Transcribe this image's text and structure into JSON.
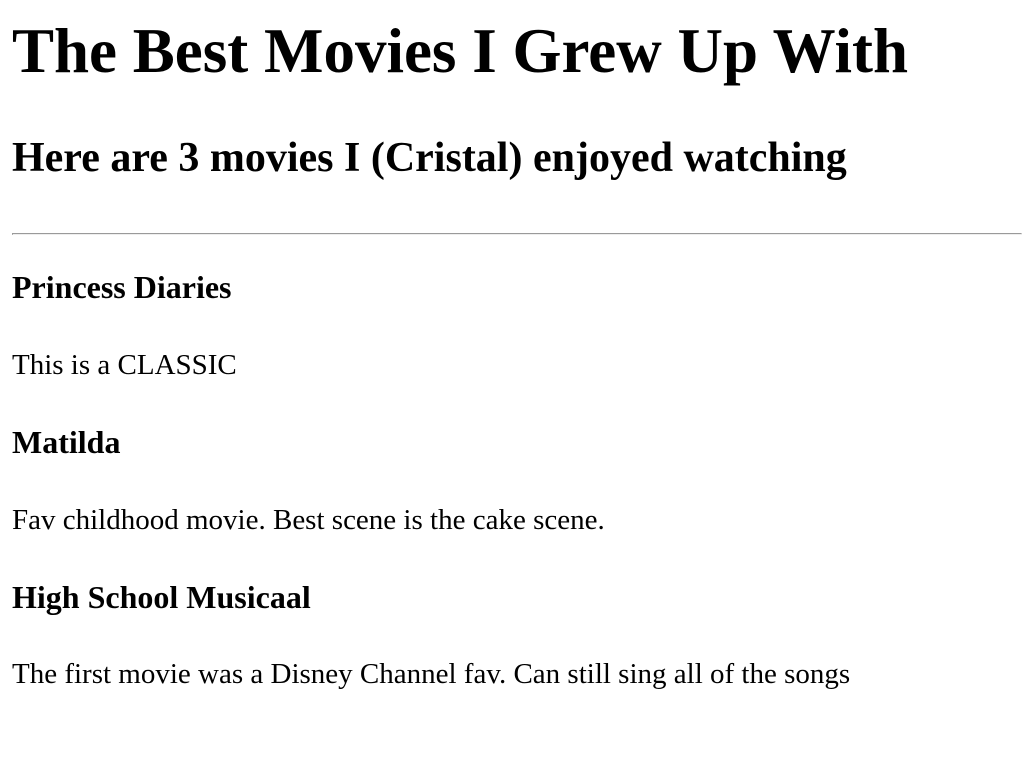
{
  "page": {
    "title": "The Best Movies I Grew Up With",
    "subtitle": "Here are 3 movies I (Cristal) enjoyed watching"
  },
  "movies": [
    {
      "title": "Princess Diaries",
      "description": "This is a CLASSIC"
    },
    {
      "title": "Matilda",
      "description": "Fav childhood movie. Best scene is the cake scene."
    },
    {
      "title": "High School Musicaal",
      "description": "The first movie was a Disney Channel fav. Can still sing all of the songs"
    }
  ]
}
